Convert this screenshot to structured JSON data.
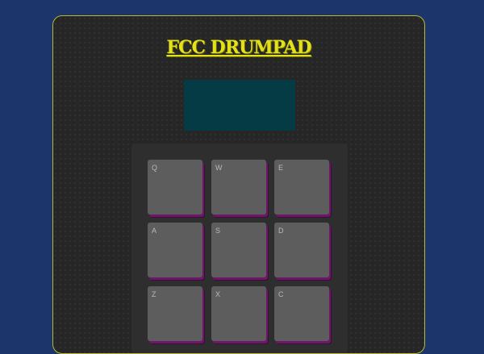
{
  "header": {
    "title": "FCC DRUMPAD"
  },
  "display": {
    "text": ""
  },
  "pads": [
    {
      "key": "Q"
    },
    {
      "key": "W"
    },
    {
      "key": "E"
    },
    {
      "key": "A"
    },
    {
      "key": "S"
    },
    {
      "key": "D"
    },
    {
      "key": "Z"
    },
    {
      "key": "X"
    },
    {
      "key": "C"
    }
  ],
  "colors": {
    "page_background": "#1c356b",
    "machine_background": "#262626",
    "title": "#e3e21a",
    "display_background": "#053b44",
    "pad": "#5d5d5d",
    "pad_shadow": "#6e1668"
  }
}
